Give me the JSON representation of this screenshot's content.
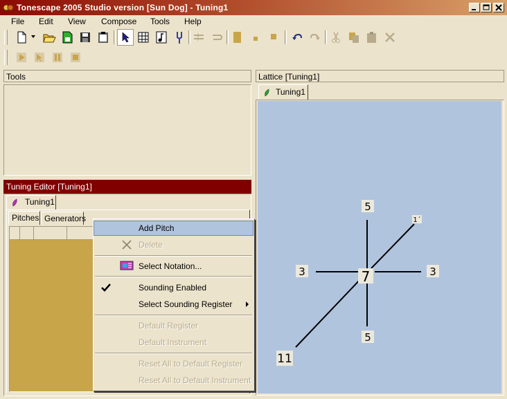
{
  "window": {
    "title": "Tonescape 2005 Studio  version [Sun Dog]  -  Tuning1",
    "minimize_label": "minimize",
    "maximize_label": "maximize",
    "close_label": "close"
  },
  "menu": {
    "file": "File",
    "edit": "Edit",
    "view": "View",
    "compose": "Compose",
    "tools": "Tools",
    "help": "Help"
  },
  "tools_panel": {
    "title": "Tools"
  },
  "lattice_panel": {
    "title": "Lattice  [Tuning1]",
    "tab_label": "Tuning1",
    "background": "#b0c4de",
    "nodes": {
      "center": "7",
      "top": "5",
      "bottom": "5",
      "left": "3",
      "right": "3",
      "upper_right": "1´",
      "lower_left": "11"
    }
  },
  "tuning_editor": {
    "title": "Tuning Editor  [Tuning1]",
    "tab_label": "Tuning1",
    "subtabs": {
      "pitches": "Pitches",
      "generators": "Generators"
    }
  },
  "context_menu": {
    "add_pitch": "Add Pitch",
    "delete": "Delete",
    "select_notation": "Select Notation...",
    "sounding_enabled": "Sounding Enabled",
    "select_sounding_register": "Select Sounding Register",
    "default_register": "Default Register",
    "default_instrument": "Default Instrument",
    "reset_register": "Reset All to Default Register",
    "reset_instrument": "Reset All to Default Instrument",
    "highlight_color": "#b0c4de"
  },
  "colors": {
    "title_bar": "#8b0a03",
    "editor_header": "#800000",
    "grid_fill": "#c9a54a",
    "face": "#ece3cc"
  }
}
